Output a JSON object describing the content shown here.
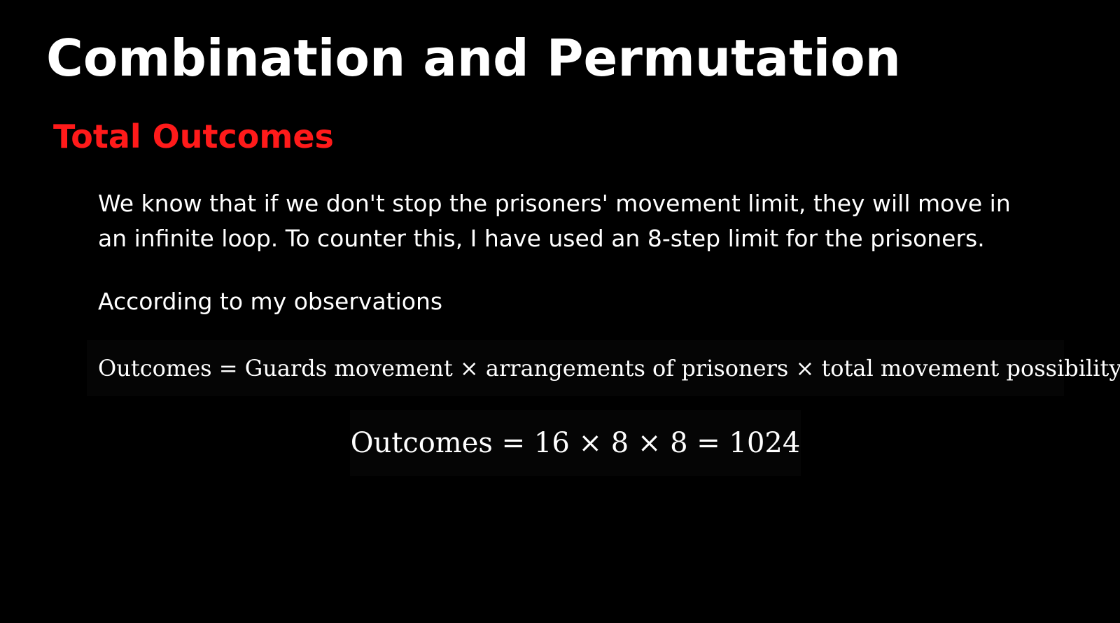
{
  "slide": {
    "title": "Combination and Permutation",
    "section_heading": "Total Outcomes",
    "paragraph": "We know that if we don't stop the prisoners' movement limit, they will move in an infinite loop. To counter this, I have used an 8-step limit for the prisoners.",
    "observations_label": "According to my observations",
    "formula": "Outcomes = Guards movement × arrangements of prisoners × total movement possibility",
    "result": "Outcomes = 16 × 8 × 8 = 1024"
  },
  "colors": {
    "background": "#000000",
    "title": "#ffffff",
    "heading": "#ff1a1a",
    "body_text": "#ffffff"
  }
}
